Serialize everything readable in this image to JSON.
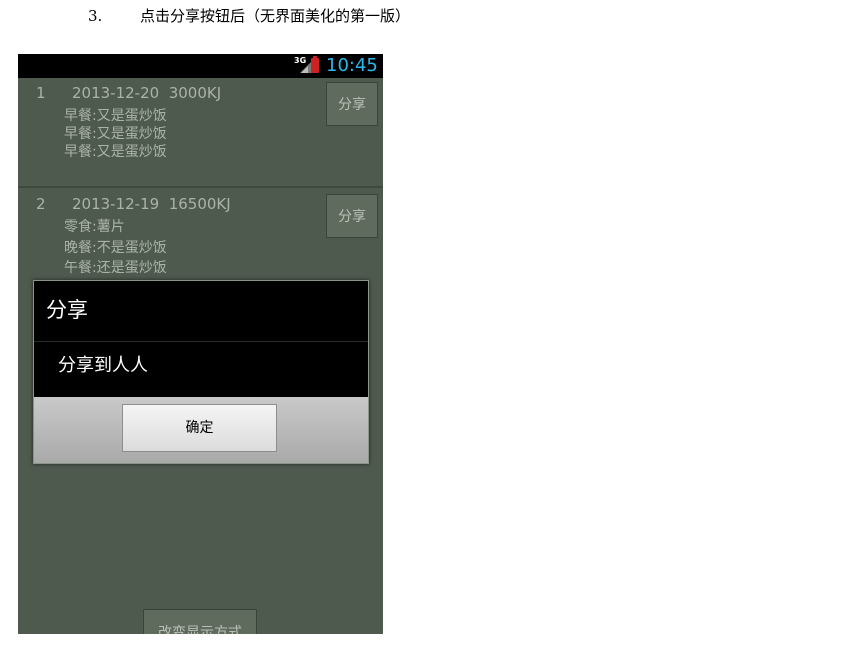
{
  "caption": {
    "number": "3.",
    "text": "点击分享按钮后（无界面美化的第一版）"
  },
  "status_bar": {
    "network": "3G",
    "time": "10:45",
    "battery_color": "#cc2222",
    "clock_color": "#2bb7ea"
  },
  "list": {
    "items": [
      {
        "index": "1",
        "header": "2013-12-20  3000KJ",
        "meals": [
          "早餐:又是蛋炒饭",
          "早餐:又是蛋炒饭",
          "早餐:又是蛋炒饭"
        ],
        "share_label": "分享"
      },
      {
        "index": "2",
        "header": "2013-12-19  16500KJ",
        "meals": [
          "零食:薯片",
          "晚餐:不是蛋炒饭",
          "午餐:还是蛋炒饭"
        ],
        "share_label": "分享"
      }
    ]
  },
  "dialog": {
    "title": "分享",
    "message": "分享到人人",
    "ok_label": "确定"
  },
  "footer": {
    "change_display_label": "改变显示方式"
  }
}
